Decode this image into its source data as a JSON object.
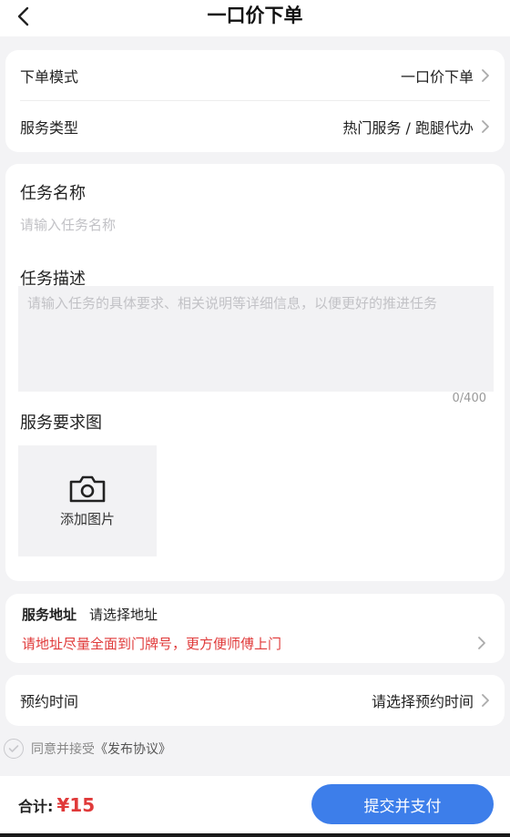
{
  "navbar": {
    "title": "一口价下单"
  },
  "order": {
    "mode_label": "下单模式",
    "mode_value": "一口价下单",
    "service_type_label": "服务类型",
    "service_type_value": "热门服务 / 跑腿代办"
  },
  "task": {
    "name_label": "任务名称",
    "name_placeholder": "请输入任务名称",
    "desc_label": "任务描述",
    "desc_placeholder": "请输入任务的具体要求、相关说明等详细信息，以便更好的推进任务",
    "desc_counter": "0/400",
    "image_label": "服务要求图",
    "add_image_label": "添加图片"
  },
  "address": {
    "label": "服务地址",
    "value": "请选择地址",
    "tip": "请地址尽量全面到门牌号，更方便师傅上门"
  },
  "appointment": {
    "label": "预约时间",
    "value": "请选择预约时间"
  },
  "agreement": {
    "text": "同意并接受",
    "link": "《发布协议》"
  },
  "footer": {
    "total_label": "合计:",
    "total_amount": "¥15",
    "submit_label": "提交并支付"
  },
  "icons": {
    "back": "back-arrow-icon",
    "chevron": "chevron-right-icon",
    "camera": "camera-icon",
    "check": "check-circle-icon"
  },
  "colors": {
    "accent": "#3d7eea",
    "warning": "#e03a3a",
    "background": "#f3f3f5"
  }
}
